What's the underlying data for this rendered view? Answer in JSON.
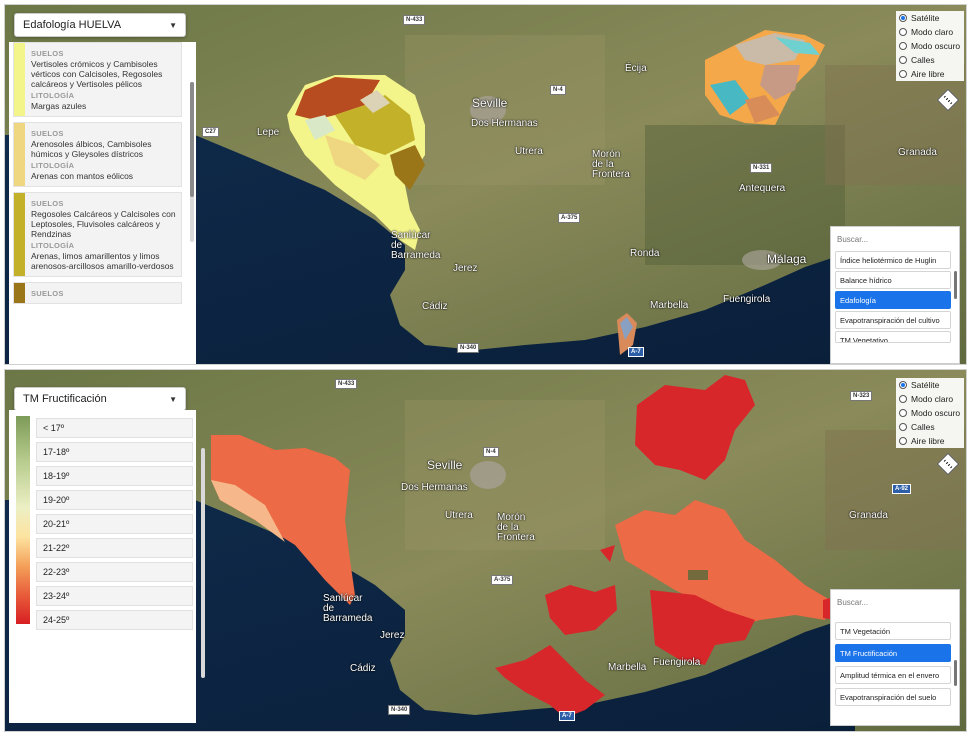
{
  "top": {
    "layer_select": "Edafología HUELVA",
    "legend": {
      "soil_header": "SUELOS",
      "lith_header": "LITOLOGÍA",
      "items": [
        {
          "color": "#f3f48a",
          "suelos": "Vertisoles crómicos y Cambisoles vérticos con Calcisoles, Regosoles calcáreos y Vertisoles pélicos",
          "litologia": "Margas azules"
        },
        {
          "color": "#eed780",
          "suelos": "Arenosoles álbicos, Cambisoles húmicos y Gleysoles dístricos",
          "litologia": "Arenas con mantos eólicos"
        },
        {
          "color": "#c3b12a",
          "suelos": "Regosoles Calcáreos y Calcisoles con Leptosoles, Fluvisoles calcáreos y Rendzinas",
          "litologia": "Arenas, limos amarillentos y limos arenosos-arcillosos amarillo-verdosos"
        },
        {
          "color": "#9a7619",
          "suelos": "",
          "litologia": ""
        }
      ]
    },
    "search_placeholder": "Buscar...",
    "layers": [
      "Índice heliotérmico de Huglin",
      "Balance hídrico",
      "Edafología",
      "Evapotranspiración del cultivo",
      "TM Vegetativo"
    ],
    "selected_layer": "Edafología"
  },
  "bottom": {
    "layer_select": "TM Fructificación",
    "legend": [
      "< 17º",
      "17-18º",
      "18-19º",
      "19-20º",
      "20-21º",
      "21-22º",
      "22-23º",
      "23-24º",
      "24-25º"
    ],
    "search_placeholder": "Buscar...",
    "layers": [
      "TM Vegetación",
      "TM Fructificación",
      "Amplitud térmica en el envero",
      "Evapotranspiración del suelo"
    ],
    "selected_layer": "TM Fructificación"
  },
  "basemap": [
    "Satélite",
    "Modo claro",
    "Modo oscuro",
    "Calles",
    "Aire libre"
  ],
  "basemap_selected": "Satélite",
  "map_labels": {
    "seville": "Seville",
    "dos_hermanas": "Dos Hermanas",
    "utrera": "Utrera",
    "moron": "Morón de la Frontera",
    "ecija": "Écija",
    "sanlucar": "Sanlúcar de Barrameda",
    "jerez": "Jerez",
    "cadiz": "Cádiz",
    "ronda": "Ronda",
    "malaga": "Málaga",
    "marbella": "Marbella",
    "fuengirola": "Fuengirola",
    "antequera": "Antequera",
    "granada": "Granada",
    "lepe": "Lepe"
  },
  "roads": {
    "n433": "N-433",
    "n4": "N-4",
    "n331": "N-331",
    "a375": "A-375",
    "n340": "N-340",
    "n323": "N-323",
    "a92": "A-92",
    "c27": "C27",
    "a7": "A-7"
  }
}
